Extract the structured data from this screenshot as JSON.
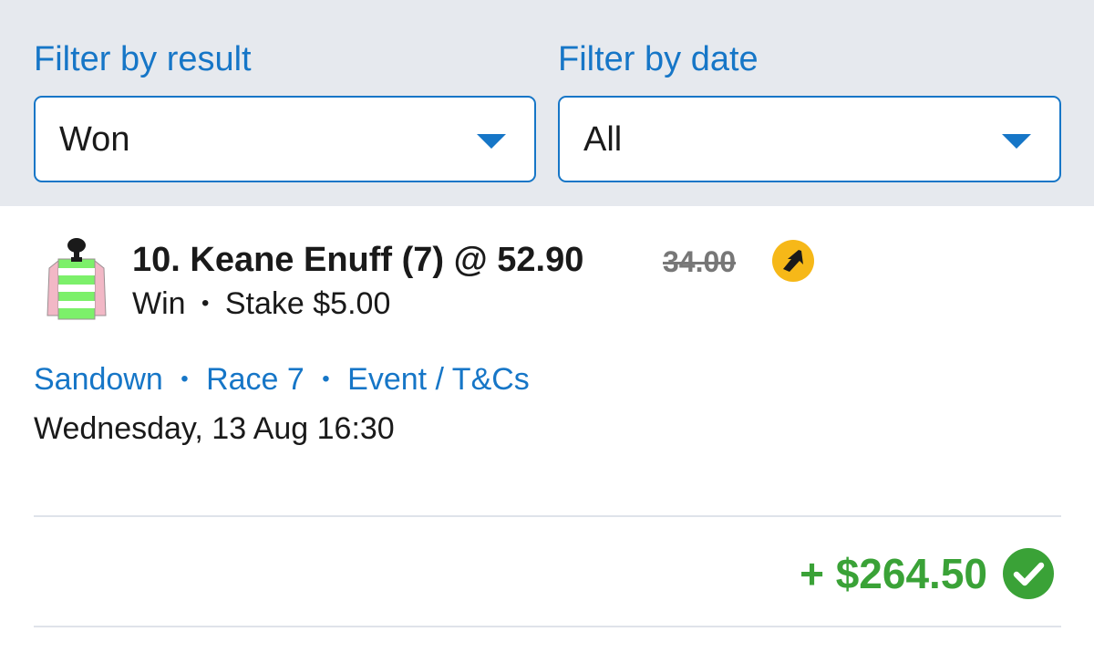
{
  "filters": {
    "result": {
      "label": "Filter by result",
      "value": "Won"
    },
    "date": {
      "label": "Filter by date",
      "value": "All"
    }
  },
  "bet": {
    "title": "10. Keane Enuff (7) @ 52.90",
    "old_odds": "34.00",
    "bet_type": "Win",
    "separator": "•",
    "stake": "Stake $5.00",
    "boost_icon": "odds-boost-arrow-icon",
    "silks_colors": {
      "body": "#7cf06a",
      "stripes": "#ffffff",
      "sleeves": "#f2b8c6",
      "cap": "#1a1a1a"
    }
  },
  "event": {
    "venue": "Sandown",
    "race": "Race 7",
    "terms": "Event / T&Cs",
    "datetime": "Wednesday, 13 Aug 16:30"
  },
  "result": {
    "payout": "+ $264.50",
    "status_icon": "check-circle-icon",
    "color": "#3aa237"
  },
  "colors": {
    "accent": "#1676c7",
    "filter_bg": "#e6e9ee",
    "boost": "#f6b818"
  }
}
